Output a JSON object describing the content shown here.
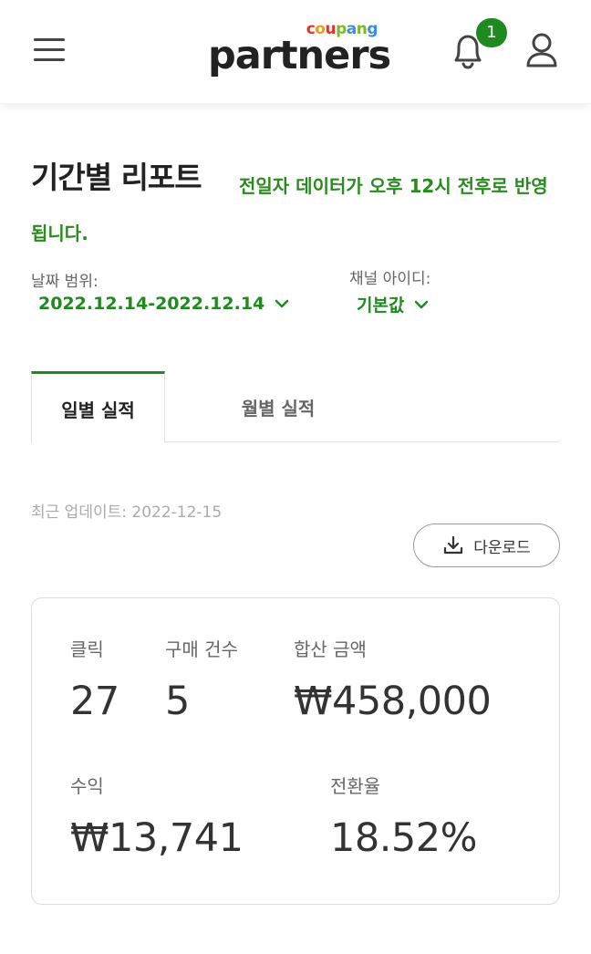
{
  "header": {
    "logo_top": "coupang",
    "logo_main": "partners",
    "notification_count": "1"
  },
  "page": {
    "title": "기간별 리포트",
    "notice": "전일자 데이터가 오후 12시 전후로 반영됩니다."
  },
  "filters": {
    "date_label": "날짜 범위:",
    "date_value": "2022.12.14-2022.12.14",
    "channel_label": "채널 아이디:",
    "channel_value": "기본값"
  },
  "tabs": [
    {
      "label": "일별 실적",
      "active": true
    },
    {
      "label": "월별 실적",
      "active": false
    }
  ],
  "updated": "최근 업데이트: 2022-12-15",
  "download_label": "다운로드",
  "metrics": {
    "clicks_label": "클릭",
    "clicks_value": "27",
    "orders_label": "구매 건수",
    "orders_value": "5",
    "total_label": "합산 금액",
    "total_value": "₩458,000",
    "revenue_label": "수익",
    "revenue_value": "₩13,741",
    "conversion_label": "전환율",
    "conversion_value": "18.52%"
  },
  "colors": {
    "accent_green": "#1f8a1f",
    "logo_letters": [
      "#e5302b",
      "#f29b1a",
      "#e5302b",
      "#7ab929",
      "#3a8fd6",
      "#7ab929",
      "#3a8fd6"
    ]
  }
}
